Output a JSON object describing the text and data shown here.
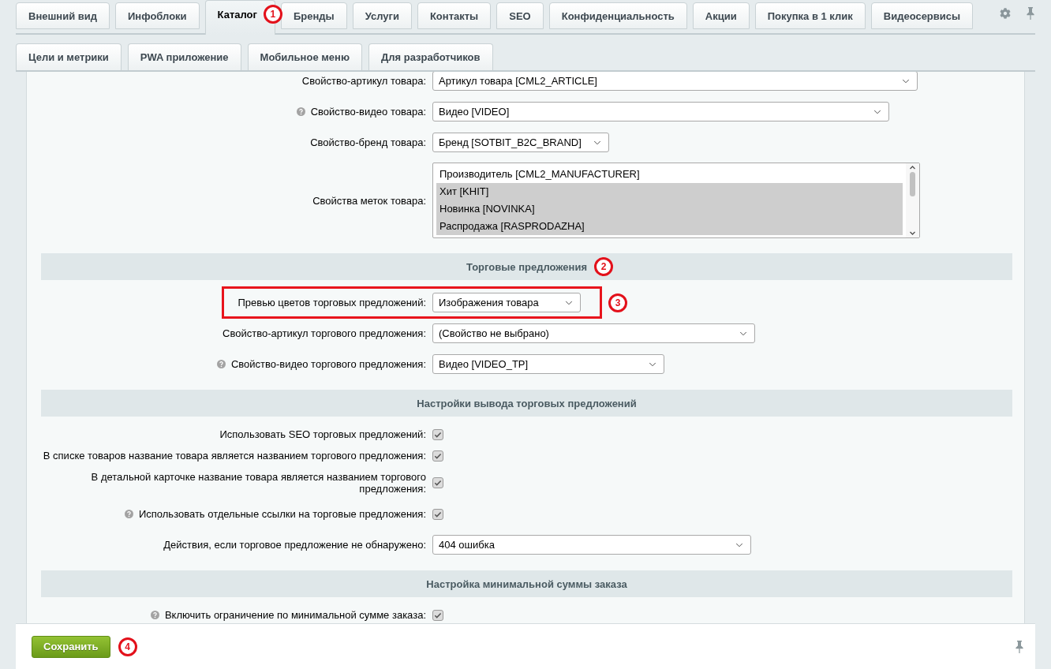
{
  "tabs_row_1": [
    {
      "label": "Внешний вид",
      "selected": false
    },
    {
      "label": "Инфоблоки",
      "selected": false
    },
    {
      "label": "Каталог",
      "selected": true,
      "marker": "1"
    },
    {
      "label": "Бренды",
      "selected": false
    },
    {
      "label": "Услуги",
      "selected": false
    },
    {
      "label": "Контакты",
      "selected": false
    },
    {
      "label": "SEO",
      "selected": false
    },
    {
      "label": "Конфиденциальность",
      "selected": false
    },
    {
      "label": "Акции",
      "selected": false
    },
    {
      "label": "Покупка в 1 клик",
      "selected": false
    },
    {
      "label": "Видеосервисы",
      "selected": false
    }
  ],
  "tabs_row_2": [
    {
      "label": "Цели и метрики",
      "selected": false
    },
    {
      "label": "PWA приложение",
      "selected": false
    },
    {
      "label": "Мобильное меню",
      "selected": false
    },
    {
      "label": "Для разработчиков",
      "selected": false
    }
  ],
  "form": [
    {
      "kind": "select",
      "label": "Свойство-артикул товара:",
      "help": false,
      "highlighted": false,
      "value": "Артикул товара [CML2_ARTICLE]"
    },
    {
      "kind": "select",
      "label": "Свойство-видео товара:",
      "help": true,
      "highlighted": false,
      "value": "Видео [VIDEO]"
    },
    {
      "kind": "select",
      "label": "Свойство-бренд товара:",
      "help": false,
      "highlighted": false,
      "value": "Бренд [SOTBIT_B2C_BRAND]"
    },
    {
      "kind": "multiselect",
      "label": "Свойства меток товара:",
      "help": false,
      "highlighted": false,
      "options": [
        {
          "label": "Производитель [CML2_MANUFACTURER]",
          "selected": false
        },
        {
          "label": "Хит [KHIT]",
          "selected": true
        },
        {
          "label": "Новинка [NOVINKA]",
          "selected": true
        },
        {
          "label": "Распродажа [RASPRODAZHA]",
          "selected": true
        }
      ]
    },
    {
      "kind": "section",
      "title": "Торговые предложения",
      "marker": "2"
    },
    {
      "kind": "select",
      "label": "Превью цветов торговых предложений:",
      "help": false,
      "highlighted": true,
      "value": "Изображения товара",
      "marker": "3"
    },
    {
      "kind": "select",
      "label": "Свойство-артикул торгового предложения:",
      "help": false,
      "highlighted": false,
      "value": "(Свойство не выбрано)"
    },
    {
      "kind": "select",
      "label": "Свойство-видео торгового предложения:",
      "help": true,
      "highlighted": false,
      "value": "Видео [VIDEO_TP]"
    },
    {
      "kind": "section",
      "title": "Настройки вывода торговых предложений"
    },
    {
      "kind": "checkbox",
      "label": "Использовать SEO торговых предложений:",
      "help": false,
      "highlighted": false,
      "checked": true
    },
    {
      "kind": "checkbox",
      "label": "В списке товаров название товара является названием торгового предложения:",
      "help": false,
      "highlighted": false,
      "checked": true
    },
    {
      "kind": "checkbox",
      "label": "В детальной карточке название товара является названием торгового предложения:",
      "help": false,
      "highlighted": false,
      "checked": true
    },
    {
      "kind": "checkbox",
      "label": "Использовать отдельные ссылки на торговые предложения:",
      "help": true,
      "highlighted": false,
      "checked": true
    },
    {
      "kind": "select",
      "label": "Действия, если торговое предложение не обнаружено:",
      "help": false,
      "highlighted": false,
      "value": "404 ошибка"
    },
    {
      "kind": "section",
      "title": "Настройка минимальной суммы заказа"
    },
    {
      "kind": "checkbox",
      "label": "Включить ограничение по минимальной сумме заказа:",
      "help": true,
      "highlighted": false,
      "checked": true
    }
  ],
  "footer": {
    "save_button": "Сохранить",
    "marker": "4"
  }
}
